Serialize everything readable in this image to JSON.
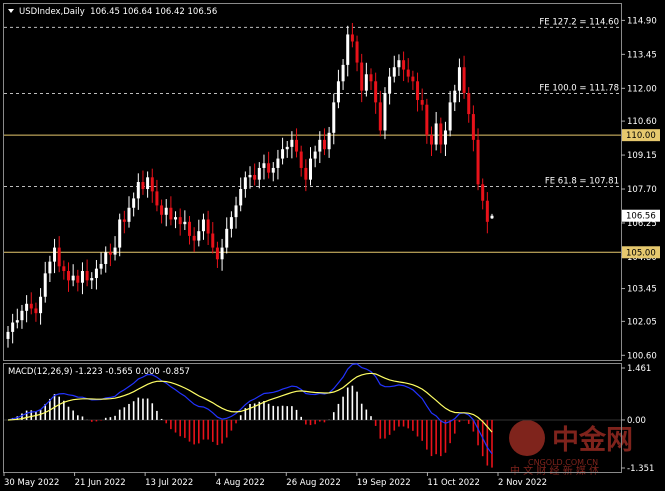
{
  "header": {
    "symbol_line": "USDIndex,Daily  106.45 106.64 106.42 106.56"
  },
  "macd": {
    "label": "MACD(12,26,9) -1.223 -0.565 0.000 -0.857",
    "ticks": [
      {
        "value": 1.461,
        "label": "1.461"
      },
      {
        "value": 0.0,
        "label": "0.00"
      },
      {
        "value": -1.351,
        "label": "-1.351"
      }
    ],
    "ylim": [
      -1.351,
      1.461
    ]
  },
  "price_axis": {
    "ticks": [
      {
        "value": 114.9,
        "label": "114.90"
      },
      {
        "value": 113.45,
        "label": "113.45"
      },
      {
        "value": 112.0,
        "label": "112.00"
      },
      {
        "value": 110.6,
        "label": "110.60"
      },
      {
        "value": 109.15,
        "label": "109.15"
      },
      {
        "value": 107.7,
        "label": "107.70"
      },
      {
        "value": 106.25,
        "label": "106.25"
      },
      {
        "value": 104.8,
        "label": "104.80"
      },
      {
        "value": 103.45,
        "label": "103.45"
      },
      {
        "value": 102.05,
        "label": "102.05"
      },
      {
        "value": 100.6,
        "label": "100.60"
      }
    ],
    "current_price": {
      "value": 106.56,
      "label": "106.56"
    },
    "ylim": [
      100.4,
      115.6
    ]
  },
  "levels": [
    {
      "value": 110.0,
      "label": "110.00",
      "color": "#e6c86e"
    },
    {
      "value": 105.0,
      "label": "105.00",
      "color": "#e6c86e"
    }
  ],
  "fib_levels": [
    {
      "value": 114.6,
      "label": "FE 127.2 = 114.60"
    },
    {
      "value": 111.78,
      "label": "FE 100.0 = 111.78"
    },
    {
      "value": 107.81,
      "label": "FE 61.8 = 107.81"
    }
  ],
  "time_axis": {
    "labels": [
      "30 May 2022",
      "21 Jun 2022",
      "13 Jul 2022",
      "4 Aug 2022",
      "26 Aug 2022",
      "19 Sep 2022",
      "11 Oct 2022",
      "2 Nov 2022"
    ]
  },
  "watermark": {
    "brand": "中金网",
    "site": "CNGOLD.COM.CN",
    "slogan": "中 文 财 经 新 媒 体"
  },
  "colors": {
    "bull": "#ffffff",
    "bear": "#e8121a",
    "level": "#e6c86e",
    "signal": "#ffff66",
    "macd_line": "#2233ff",
    "grid": "#7a7a7a",
    "watermark": "#c8392e"
  },
  "chart_data": {
    "type": "candlestick",
    "symbol": "USDIndex",
    "timeframe": "Daily",
    "ohlc_last": {
      "open": 106.45,
      "high": 106.64,
      "low": 106.42,
      "close": 106.56
    },
    "closes": [
      101.6,
      102.0,
      102.1,
      102.5,
      102.8,
      102.6,
      102.4,
      103.1,
      104.1,
      104.6,
      105.2,
      104.4,
      104.2,
      103.8,
      104.0,
      103.7,
      104.2,
      103.8,
      103.9,
      104.3,
      104.5,
      105.0,
      104.9,
      105.2,
      106.4,
      106.3,
      106.9,
      107.3,
      108.0,
      107.7,
      108.2,
      107.6,
      107.0,
      106.6,
      106.9,
      106.4,
      106.5,
      106.2,
      106.3,
      105.7,
      105.5,
      105.9,
      106.4,
      105.8,
      105.2,
      104.7,
      105.2,
      106.0,
      106.5,
      107.0,
      107.7,
      108.2,
      108.3,
      108.1,
      108.6,
      108.8,
      108.4,
      108.6,
      109.0,
      109.4,
      109.5,
      109.8,
      109.3,
      108.6,
      108.1,
      109.0,
      109.3,
      109.8,
      109.4,
      110.1,
      111.4,
      112.3,
      113.0,
      114.3,
      114.0,
      113.1,
      111.9,
      112.6,
      112.3,
      111.4,
      110.2,
      111.8,
      112.5,
      112.9,
      113.2,
      112.8,
      112.5,
      112.3,
      111.5,
      111.3,
      110.0,
      109.6,
      110.5,
      109.6,
      110.2,
      111.4,
      111.9,
      112.9,
      111.8,
      110.9,
      109.8,
      107.9,
      107.2,
      106.3,
      106.56
    ]
  }
}
